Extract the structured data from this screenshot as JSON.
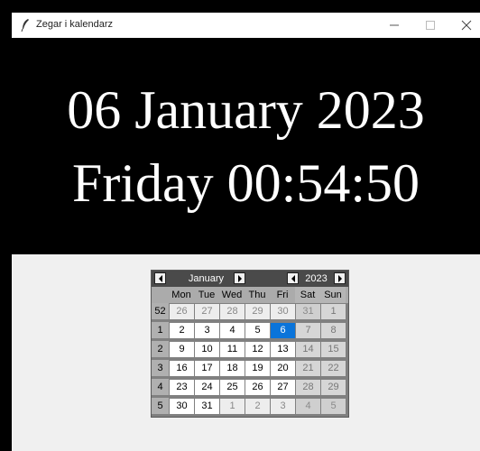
{
  "window": {
    "title": "Zegar i kalendarz",
    "icon": "feather-icon"
  },
  "clock": {
    "date_line": "06 January 2023",
    "time_line": "Friday 00:54:50"
  },
  "calendar": {
    "month": "January",
    "year": "2023",
    "day_headers": [
      "Mon",
      "Tue",
      "Wed",
      "Thu",
      "Fri",
      "Sat",
      "Sun"
    ],
    "weeks": [
      {
        "week": "52",
        "days": [
          {
            "d": "26",
            "other": true
          },
          {
            "d": "27",
            "other": true
          },
          {
            "d": "28",
            "other": true
          },
          {
            "d": "29",
            "other": true
          },
          {
            "d": "30",
            "other": true
          },
          {
            "d": "31",
            "other": true
          },
          {
            "d": "1"
          }
        ]
      },
      {
        "week": "1",
        "days": [
          {
            "d": "2"
          },
          {
            "d": "3"
          },
          {
            "d": "4"
          },
          {
            "d": "5"
          },
          {
            "d": "6",
            "selected": true
          },
          {
            "d": "7"
          },
          {
            "d": "8"
          }
        ]
      },
      {
        "week": "2",
        "days": [
          {
            "d": "9"
          },
          {
            "d": "10"
          },
          {
            "d": "11"
          },
          {
            "d": "12"
          },
          {
            "d": "13"
          },
          {
            "d": "14"
          },
          {
            "d": "15"
          }
        ]
      },
      {
        "week": "3",
        "days": [
          {
            "d": "16"
          },
          {
            "d": "17"
          },
          {
            "d": "18"
          },
          {
            "d": "19"
          },
          {
            "d": "20"
          },
          {
            "d": "21"
          },
          {
            "d": "22"
          }
        ]
      },
      {
        "week": "4",
        "days": [
          {
            "d": "23"
          },
          {
            "d": "24"
          },
          {
            "d": "25"
          },
          {
            "d": "26"
          },
          {
            "d": "27"
          },
          {
            "d": "28"
          },
          {
            "d": "29"
          }
        ]
      },
      {
        "week": "5",
        "days": [
          {
            "d": "30"
          },
          {
            "d": "31"
          },
          {
            "d": "1",
            "other": true
          },
          {
            "d": "2",
            "other": true
          },
          {
            "d": "3",
            "other": true
          },
          {
            "d": "4",
            "other": true
          },
          {
            "d": "5",
            "other": true
          }
        ]
      }
    ],
    "colors": {
      "selected": "#0a74da",
      "header": "#4a4a4a"
    }
  }
}
